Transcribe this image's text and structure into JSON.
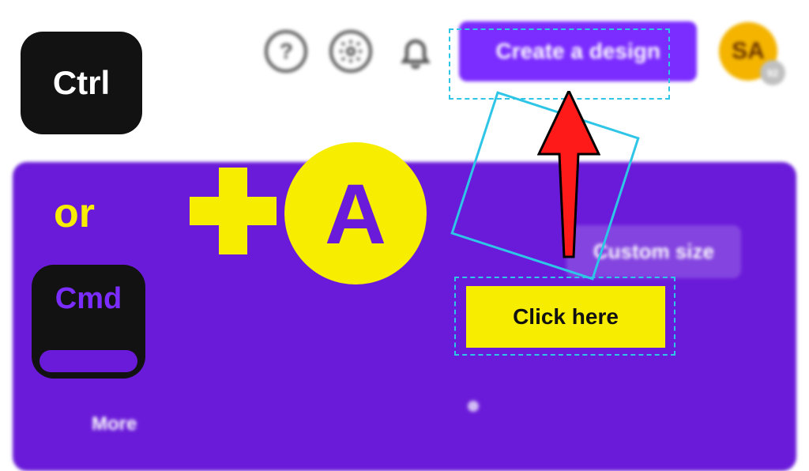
{
  "topbar": {
    "help_icon": "?",
    "create_label": "Create a design",
    "avatar_initials": "SA",
    "avatar_badge": "92"
  },
  "banner": {
    "custom_size_label": "Custom size",
    "more_label": "More"
  },
  "annotation": {
    "click_here_label": "Click here"
  },
  "shortcut": {
    "ctrl_label": "Ctrl",
    "cmd_label": "Cmd",
    "or_label": "or",
    "a_label": "A"
  }
}
